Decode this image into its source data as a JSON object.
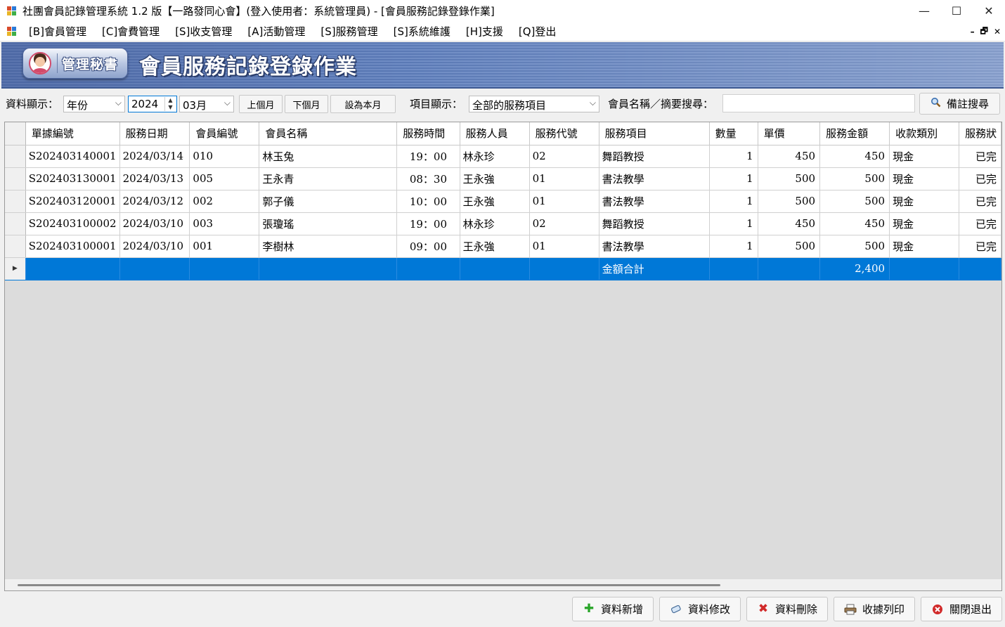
{
  "window": {
    "title": "社團會員記錄管理系統 1.2 版【一路發同心會】(登入使用者：系統管理員) - [會員服務記錄登錄作業]",
    "minimize": "—",
    "maximize": "☐",
    "close": "✕"
  },
  "menu": {
    "items": [
      "[B]會員管理",
      "[C]會費管理",
      "[S]收支管理",
      "[A]活動管理",
      "[S]服務管理",
      "[S]系統維護",
      "[H]支援",
      "[Q]登出"
    ],
    "mdi_minimize": "–",
    "mdi_restore": "🗗",
    "mdi_close": "✕"
  },
  "banner": {
    "badge_text": "管理秘書",
    "title": "會員服務記錄登錄作業"
  },
  "filters": {
    "display_label": "資料顯示：",
    "mode_value": "年份",
    "year_value": "2024",
    "month_value": "03月",
    "prev_month": "上個月",
    "next_month": "下個月",
    "this_month": "設為本月",
    "item_label": "項目顯示：",
    "item_value": "全部的服務項目",
    "search_label": "會員名稱／摘要搜尋：",
    "search_value": "",
    "search_button": "備註搜尋"
  },
  "table": {
    "columns": [
      "單據編號",
      "服務日期",
      "會員編號",
      "會員名稱",
      "服務時間",
      "服務人員",
      "服務代號",
      "服務項目",
      "數量",
      "單價",
      "服務金額",
      "收款類別",
      "服務狀"
    ],
    "rows": [
      [
        "S202403140001",
        "2024/03/14",
        "010",
        "林玉兔",
        "19：00",
        "林永珍",
        "02",
        "舞蹈教授",
        "1",
        "450",
        "450",
        "現金",
        "已完"
      ],
      [
        "S202403130001",
        "2024/03/13",
        "005",
        "王永青",
        "08：30",
        "王永強",
        "01",
        "書法教學",
        "1",
        "500",
        "500",
        "現金",
        "已完"
      ],
      [
        "S202403120001",
        "2024/03/12",
        "002",
        "郭子儀",
        "10：00",
        "王永強",
        "01",
        "書法教學",
        "1",
        "500",
        "500",
        "現金",
        "已完"
      ],
      [
        "S202403100002",
        "2024/03/10",
        "003",
        "張瓊瑤",
        "19：00",
        "林永珍",
        "02",
        "舞蹈教授",
        "1",
        "450",
        "450",
        "現金",
        "已完"
      ],
      [
        "S202403100001",
        "2024/03/10",
        "001",
        "李樹林",
        "09：00",
        "王永強",
        "01",
        "書法教學",
        "1",
        "500",
        "500",
        "現金",
        "已完"
      ]
    ],
    "total_label": "金額合計",
    "total_amount": "2,400",
    "current_row_marker": "▶"
  },
  "actions": {
    "add": "資料新增",
    "edit": "資料修改",
    "delete": "資料刪除",
    "print": "收據列印",
    "exit": "關閉退出"
  },
  "colors": {
    "banner": "#6f8cc4",
    "selection": "#0078d7",
    "add_icon": "#2aa52a",
    "delete_icon": "#d12a2a"
  }
}
